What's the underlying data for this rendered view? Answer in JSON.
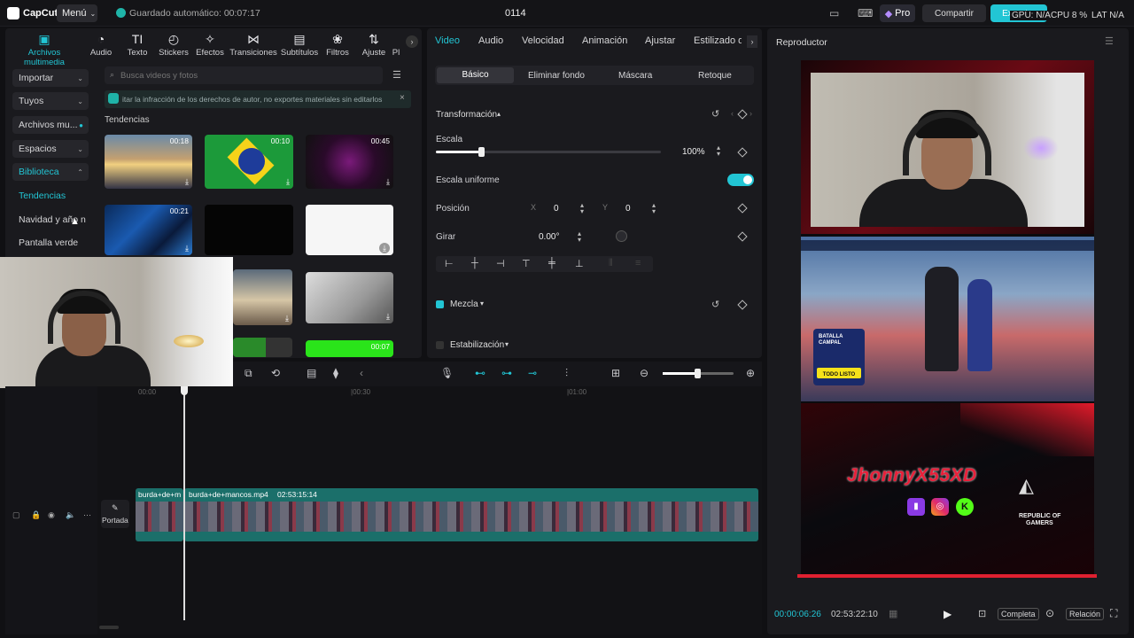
{
  "app": {
    "name": "CapCut",
    "menu": "Menú",
    "autosave": "Guardado automático: 00:07:17",
    "project": "0114"
  },
  "topbar": {
    "pro": "Pro",
    "share": "Compartir",
    "export": "Exportar",
    "gpu": "GPU: N/A",
    "cpu": "CPU 8 %",
    "lat": "LAT N/A"
  },
  "media_tabs": [
    {
      "label": "Archivos multimedia",
      "icon": "▣"
    },
    {
      "label": "Audio",
      "icon": "◔"
    },
    {
      "label": "Texto",
      "icon": "TI"
    },
    {
      "label": "Stickers",
      "icon": "◴"
    },
    {
      "label": "Efectos",
      "icon": "✧"
    },
    {
      "label": "Transiciones",
      "icon": "⋈"
    },
    {
      "label": "Subtítulos",
      "icon": "▤"
    },
    {
      "label": "Filtros",
      "icon": "❀"
    },
    {
      "label": "Ajuste",
      "icon": "⇅"
    },
    {
      "label": "Pl",
      "icon": ""
    }
  ],
  "left_nav": {
    "importar": "Importar",
    "tuyos": "Tuyos",
    "archivos": "Archivos mu...",
    "espacios": "Espacios",
    "biblioteca": "Biblioteca",
    "tendencias": "Tendencias",
    "navidad": "Navidad y año n...",
    "pantalla": "Pantalla verde"
  },
  "library": {
    "search_placeholder": "Busca videos y fotos",
    "notice": "itar la infracción de los derechos de autor, no exportes materiales sin editarlos",
    "section": "Tendencias",
    "durations": [
      "00:18",
      "00:10",
      "00:45",
      "00:21",
      "00:07"
    ]
  },
  "props": {
    "tabs": [
      "Video",
      "Audio",
      "Velocidad",
      "Animación",
      "Ajustar",
      "Estilizado d"
    ],
    "subtabs": [
      "Básico",
      "Eliminar fondo",
      "Máscara",
      "Retoque"
    ],
    "transform": "Transformación",
    "scale": "Escala",
    "scale_value": "100%",
    "uniform": "Escala uniforme",
    "position": "Posición",
    "pos_x_label": "X",
    "pos_x": "0",
    "pos_y_label": "Y",
    "pos_y": "0",
    "rotate": "Girar",
    "rotate_value": "0.00°",
    "blend": "Mezcla",
    "stabilize": "Estabilización"
  },
  "player": {
    "title": "Reproductor",
    "current": "00:00:06:26",
    "total": "02:53:22:10",
    "full": "Completa",
    "ratio": "Relación",
    "streamer": "JhonnyX55XD",
    "brand1": "REPUBLIC OF",
    "brand2": "GAMERS",
    "game_mode": "BATALLA CAMPAL",
    "game_ready": "TODO LISTO"
  },
  "timeline": {
    "ticks": [
      "00:00",
      "|00:30",
      "|01:00"
    ],
    "cover": "Portada",
    "clip1": "burda+de+m",
    "clip2": "burda+de+mancos.mp4",
    "clip2_dur": "02:53:15:14"
  },
  "colors": {
    "accent": "#22c5d4",
    "clip": "#1b6f6a",
    "red": "#e02030"
  }
}
